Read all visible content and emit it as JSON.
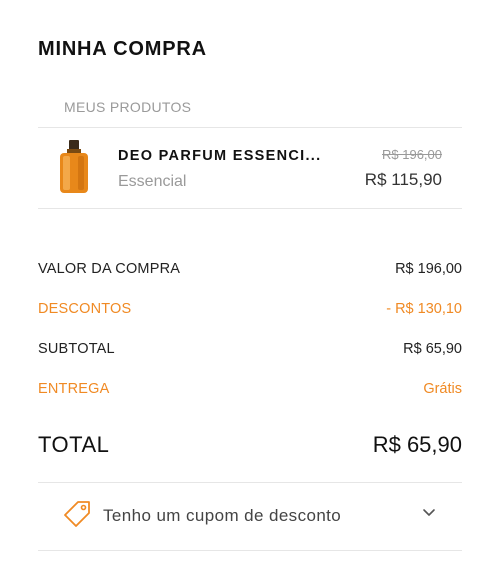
{
  "header": {
    "title": "MINHA COMPRA"
  },
  "products": {
    "section_label": "MEUS PRODUTOS",
    "items": [
      {
        "name": "DEO PARFUM ESSENCI...",
        "brand": "Essencial",
        "old_price": "R$ 196,00",
        "price": "R$ 115,90"
      }
    ]
  },
  "summary": {
    "purchase_value_label": "VALOR DA COMPRA",
    "purchase_value": "R$ 196,00",
    "discounts_label": "DESCONTOS",
    "discounts_value": "- R$ 130,10",
    "subtotal_label": "SUBTOTAL",
    "subtotal_value": "R$ 65,90",
    "delivery_label": "ENTREGA",
    "delivery_value": "Grátis"
  },
  "total": {
    "label": "TOTAL",
    "value": "R$ 65,90"
  },
  "coupon": {
    "label": "Tenho um cupom de desconto",
    "icon": "tag-icon"
  },
  "colors": {
    "accent": "#f08a24",
    "muted": "#9a9a9a",
    "divider": "#e6e6e6"
  }
}
